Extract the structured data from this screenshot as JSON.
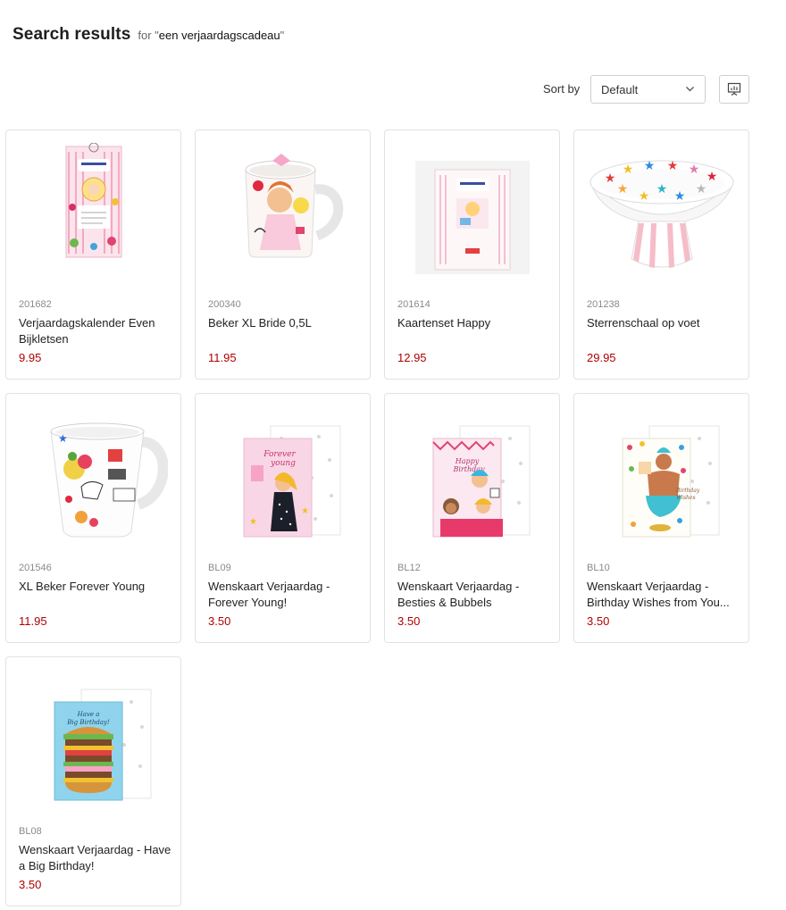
{
  "header": {
    "title": "Search results",
    "for_label": "for \"",
    "query": "een verjaardagscadeau",
    "query_close": "\""
  },
  "sort": {
    "label": "Sort by",
    "selected": "Default",
    "chevron_icon": "chevron-down-icon",
    "view_icon": "presentation-chart-icon"
  },
  "colors": {
    "price": "#b00000",
    "border": "#e2e2e2"
  },
  "products": [
    {
      "sku": "201682",
      "name": "Verjaardagskalender Even Bijkletsen",
      "price": "9.95",
      "image": "calendar"
    },
    {
      "sku": "200340",
      "name": "Beker XL Bride 0,5L",
      "price": "11.95",
      "image": "mug-bride"
    },
    {
      "sku": "201614",
      "name": "Kaartenset Happy",
      "price": "12.95",
      "image": "card-set"
    },
    {
      "sku": "201238",
      "name": "Sterrenschaal op voet",
      "price": "29.95",
      "image": "star-bowl"
    },
    {
      "sku": "201546",
      "name": "XL Beker Forever Young",
      "price": "11.95",
      "image": "mug-forever-young"
    },
    {
      "sku": "BL09",
      "name": "Wenskaart Verjaardag - Forever Young!",
      "price": "3.50",
      "image": "card-forever-young"
    },
    {
      "sku": "BL12",
      "name": "Wenskaart Verjaardag - Besties & Bubbels",
      "price": "3.50",
      "image": "card-besties"
    },
    {
      "sku": "BL10",
      "name": "Wenskaart Verjaardag - Birthday Wishes from You...",
      "price": "3.50",
      "image": "card-genie"
    },
    {
      "sku": "BL08",
      "name": "Wenskaart Verjaardag - Have a Big Birthday!",
      "price": "3.50",
      "image": "card-burger"
    }
  ]
}
